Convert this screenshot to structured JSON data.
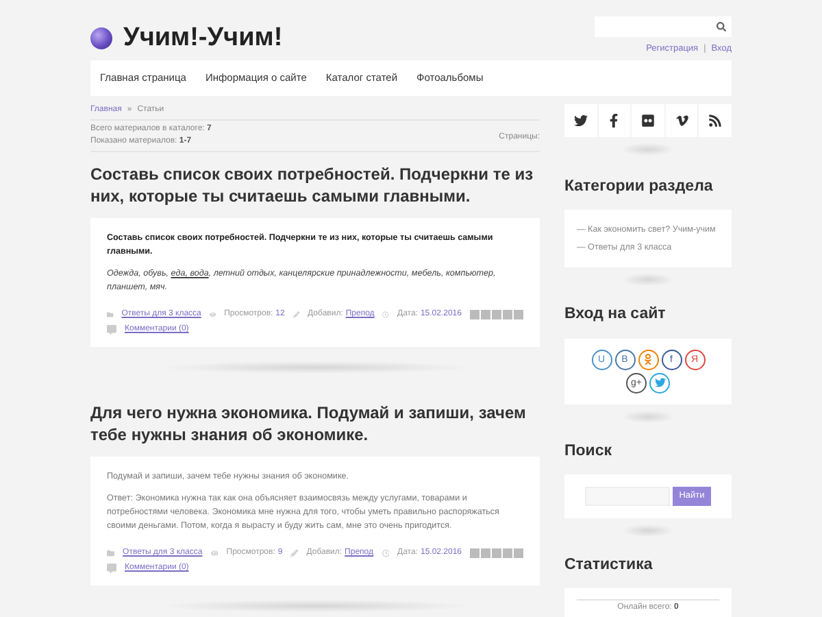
{
  "site": {
    "title": "Учим!-Учим!",
    "auth_links": [
      {
        "label": "Регистрация"
      },
      {
        "label": "Вход"
      }
    ],
    "auth_separator": "|"
  },
  "nav": [
    {
      "label": "Главная страница"
    },
    {
      "label": "Информация о сайте"
    },
    {
      "label": "Каталог статей"
    },
    {
      "label": "Фотоальбомы"
    }
  ],
  "breadcrumb": {
    "home": "Главная",
    "separator": "»",
    "current": "Статьи"
  },
  "catalog_info": {
    "total_label": "Всего материалов в каталоге:",
    "total": "7",
    "shown_label": "Показано материалов:",
    "shown": "1-7",
    "pages_label": "Страницы:"
  },
  "articles": [
    {
      "title": "Составь список своих потребностей. Подчеркни те из них, которые ты считаешь самыми главными.",
      "paragraphs": [
        {
          "kind": "bold",
          "segments": [
            {
              "text": "Составь список своих потребностей. Подчеркни те из них, которые ты считаешь самыми главными.",
              "underlined": false
            }
          ]
        },
        {
          "kind": "italic",
          "segments": [
            {
              "text": "Одежда, обувь, ",
              "underlined": false
            },
            {
              "text": "еда, вода",
              "underlined": true
            },
            {
              "text": ", летний отдых, канцелярские принадлежности, мебель, компьютер, планшет, мяч.",
              "underlined": false
            }
          ]
        }
      ],
      "category": "Ответы для 3 класса",
      "views_label": "Просмотров:",
      "views": "12",
      "author_label": "Добавил:",
      "author": "Препод",
      "date_label": "Дата:",
      "date": "15.02.2016",
      "stars": 0,
      "comments": "Комментарии (0)"
    },
    {
      "title": "Для чего нужна экономика. Подумай и запиши, зачем тебе нужны знания об экономике.",
      "paragraphs": [
        {
          "kind": "plain",
          "segments": [
            {
              "text": "Подумай и запиши, зачем тебе нужны знания об экономике.",
              "underlined": false
            }
          ]
        },
        {
          "kind": "plain",
          "segments": [
            {
              "text": "Ответ: Экономика нужна так как она объясняет взаимосвязь между услугами, товарами и потребностями человека. Экономика мне нужна для того, чтобы уметь правильно распоряжаться своими деньгами. Потом, когда я вырасту и буду жить сам, мне это очень пригодится.",
              "underlined": false
            }
          ]
        }
      ],
      "category": "Ответы для 3 класса",
      "views_label": "Просмотров:",
      "views": "9",
      "author_label": "Добавил:",
      "author": "Препод",
      "date_label": "Дата:",
      "date": "15.02.2016",
      "stars": 0,
      "comments": "Комментарии (0)"
    }
  ],
  "sidebar": {
    "categories": {
      "title": "Категории раздела",
      "items": [
        {
          "prefix": "—",
          "label": "Как экономить свет? Учим-учим"
        },
        {
          "prefix": "—",
          "label": "Ответы для 3 класса"
        }
      ]
    },
    "login": {
      "title": "Вход на сайт",
      "services": [
        {
          "kind": "letter",
          "glyph": "U",
          "color": "#4a90c8"
        },
        {
          "kind": "letter",
          "glyph": "B",
          "color": "#4a76a8"
        },
        {
          "kind": "ok",
          "color": "#ee8208"
        },
        {
          "kind": "letter",
          "glyph": "f",
          "color": "#3b5998"
        },
        {
          "kind": "letter",
          "glyph": "Я",
          "color": "#e0473c"
        },
        {
          "kind": "letter",
          "glyph": "g+",
          "color": "#555555"
        },
        {
          "kind": "twitter",
          "color": "#2ca7e0"
        }
      ]
    },
    "search": {
      "title": "Поиск",
      "button": "Найти"
    },
    "stats": {
      "title": "Статистика",
      "rows": [
        {
          "label": "Онлайн всего:",
          "value": "0"
        }
      ]
    }
  }
}
